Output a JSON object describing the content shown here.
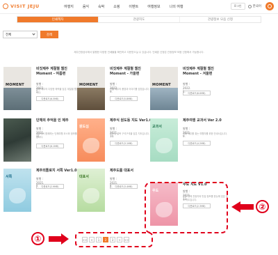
{
  "header": {
    "logo": "VISIT JEJU",
    "nav": [
      "여행지",
      "음식",
      "숙박",
      "쇼핑",
      "이벤트",
      "여행정보",
      "나의 여행"
    ],
    "util_btn": "로그인",
    "lang": "한국어"
  },
  "tabs": [
    {
      "label": "인쇄책자",
      "active": true
    },
    {
      "label": "관광지도",
      "active": false
    },
    {
      "label": "관광정보 모음 신청",
      "active": false
    }
  ],
  "filter": {
    "select": "전체",
    "search": "검색"
  },
  "notice": "제주관광공사에서 발행한 다양한 인쇄물을 확인하고 다운받으실 수 있습니다. 인쇄본 신청은 관광정보 모음 신청에서 가능합니다.",
  "cards": [
    {
      "title": "비짓제주 계절별 웹진 Moment - 여름편",
      "date": "발행 : 2022. 5.",
      "desc": "여름 제주의 다양한 매력을 담은 계절별 웹진입니다.",
      "btn": "다운로드(6.5MB)"
    },
    {
      "title": "비짓제주 계절별 웹진 Moment - 가을편",
      "date": "발행 : 2022. 9.",
      "desc": "가을 제주의 풍경과 이야기를 담았습니다.",
      "btn": "다운로드(5.8MB)"
    },
    {
      "title": "비짓제주 계절별 웹진 Moment - 겨울편",
      "date": "발행 : 2022. 1.",
      "desc": "",
      "btn": "다운로드(6.0MB)"
    },
    {
      "title": "단체의 추억을 인 제주",
      "date": "발행 : 2021. 11.",
      "desc": "제주에서 함께하는 단체여행 코스와 정보를 소개합니다.",
      "btn": "다운로드(8.1MB)"
    },
    {
      "title": "제주식 원도동 지도 Ver1.0",
      "date": "발행 : 2021. 10.",
      "desc": "원도심 골목 구석구석을 담은 지도입니다.",
      "btn": "다운로드(3.1MB)"
    },
    {
      "title": "제주여행 교과서 Ver 2.0",
      "date": "발행 : 2021. 9.",
      "desc": "처음 제주를 찾는 여행자를 위한 안내서입니다.",
      "btn": "다운로드(4.2MB)"
    },
    {
      "title": "제주외톨로지 서쪽 Ver1.0",
      "date": "발행 : 2021. 7.",
      "desc": "",
      "btn": "다운로드(2.9MB)"
    },
    {
      "title": "제주도를 대표서",
      "date": "발행 : 2021. 4.",
      "desc": "",
      "btn": "다운로드(3.4MB)"
    },
    {
      "title": "우도 지도 V1.0",
      "date": "발행 : 2021. 12.",
      "desc": "우도 전체 관광지와 맛집 정보를 한눈에 담은 우도 지도입니다.",
      "btn": "다운로드(2.3MB)"
    }
  ],
  "pager": [
    "<<",
    "<",
    "1",
    "2",
    "3",
    ">",
    ">>"
  ],
  "markers": {
    "one": "①",
    "two": "②"
  },
  "colors": {
    "accent": "#f07a2b",
    "annotation": "#e0001b"
  }
}
